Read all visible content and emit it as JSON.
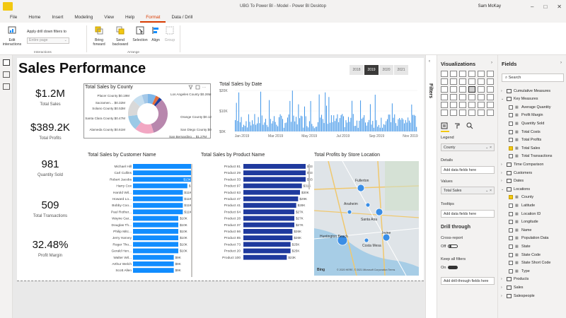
{
  "window": {
    "title": "UBG To Power BI - Model - Power BI Desktop",
    "user": "Sam McKay",
    "controls": [
      "–",
      "□",
      "✕"
    ]
  },
  "menu": {
    "items": [
      "File",
      "Home",
      "Insert",
      "Modeling",
      "View",
      "Help",
      "Format",
      "Data / Drill"
    ],
    "active": "Format"
  },
  "ribbon": {
    "edit_interactions": "Edit\ninteractions",
    "apply_filters_label": "Apply drill down filters to",
    "entire_page_placeholder": "Entire page",
    "interactions_group": "Interactions",
    "bring_forward": "Bring\nforward",
    "send_backward": "Send\nbackward",
    "selection": "Selection",
    "align": "Align",
    "group": "Group",
    "arrange_group": "Arrange"
  },
  "report": {
    "title": "Sales Performance",
    "years": [
      "2018",
      "2019",
      "2020",
      "2021"
    ],
    "selected_year": "2019",
    "kpis": [
      {
        "value": "$1.2M",
        "label": "Total Sales"
      },
      {
        "value": "$389.2K",
        "label": "Total Profits"
      },
      {
        "value": "981",
        "label": "Quantity Sold"
      },
      {
        "value": "509",
        "label": "Total Transactions"
      },
      {
        "value": "32.48%",
        "label": "Profit Margin"
      }
    ]
  },
  "chart_data": [
    {
      "type": "pie",
      "title": "Total Sales by County",
      "labels": [
        "Los Angeles County",
        "Orange County",
        "San Diego County",
        "San Bernardino County",
        "Alameda County",
        "Santa Clara County",
        "Solano County",
        "Sacramento County",
        "Placer County"
      ],
      "display": [
        "Los Angeles County $0.26M",
        "Orange County $0.12M",
        "San Diego County $0.1M",
        "San Bernardino… $1.27M",
        "Alameda County $0.61M",
        "Santa Clara County $0.47M",
        "Solano County $0.53M",
        "Sacramen… $0.32M",
        "Placer County $0.19M"
      ],
      "values": [
        0.26,
        0.12,
        0.1,
        1.27,
        0.61,
        0.47,
        0.53,
        0.32,
        0.19
      ],
      "colors": [
        "#7eb6e8",
        "#e66c37",
        "#1f3f9d",
        "#b887ad",
        "#f2a7c3",
        "#9bc9e6",
        "#d9d9d9",
        "#c7dff0",
        "#a4c8e8"
      ]
    },
    {
      "type": "bar",
      "title": "Total Sales by Date",
      "ylabel": "",
      "yticks": [
        "$20K",
        "$10K",
        "$0K"
      ],
      "xticks": [
        "Jan 2019",
        "Mar 2019",
        "May 2019",
        "Jul 2019",
        "Sep 2019",
        "Nov 2019"
      ],
      "color": "#2b8ae6"
    },
    {
      "type": "bar",
      "orientation": "horizontal",
      "title": "Total Sales by Customer Name",
      "categories": [
        "Michael Hill",
        "Carl Cullins",
        "Robert Jacobs",
        "Harry Cox",
        "Harold Wil...",
        "Howard Lo...",
        "Bobby Coo...",
        "Paul Rother...",
        "Wayne Gar...",
        "Douglas Th...",
        "Philip Mitc...",
        "Jerry Harvey",
        "Roger Tho...",
        "Gerald Hen...",
        "Walter Wil...",
        "Arthur Welch",
        "Scott Allen"
      ],
      "values": [
        15,
        15,
        13,
        12,
        11,
        11,
        11,
        11,
        10,
        10,
        10,
        10,
        10,
        10,
        9,
        9,
        9
      ],
      "labels": [
        "$15K",
        "$15K",
        "$13K",
        "$12K",
        "$11K",
        "$11K",
        "$11K",
        "$11K",
        "$10K",
        "$10K",
        "$10K",
        "$10K",
        "$10K",
        "$10K",
        "$9K",
        "$9K",
        "$9K"
      ],
      "colors": [
        "#118dff",
        "#118dff",
        "#118dff",
        "#118dff",
        "#118dff",
        "#118dff",
        "#118dff",
        "#118dff",
        "#118dff",
        "#118dff",
        "#118dff",
        "#118dff",
        "#118dff",
        "#118dff",
        "#118dff",
        "#118dff",
        "#118dff"
      ]
    },
    {
      "type": "bar",
      "orientation": "horizontal",
      "title": "Total Sales by Product Name",
      "categories": [
        "Product 81",
        "Product 29",
        "Product 33",
        "Product 97",
        "Product 63",
        "Product 47",
        "Product 41",
        "Product 64",
        "Product 28",
        "Product 37",
        "Product 66",
        "Product 85",
        "Product 73",
        "Product 20",
        "Product 100"
      ],
      "values": [
        33,
        33,
        33,
        31,
        30,
        29,
        28,
        27,
        27,
        27,
        26,
        26,
        25,
        25,
        23
      ],
      "labels": [
        "$33K",
        "$33K",
        "$33K",
        "$31K",
        "$30K",
        "$29K",
        "$28K",
        "$27K",
        "$27K",
        "$27K",
        "$26K",
        "$26K",
        "$25K",
        "$25K",
        "$23K"
      ],
      "color": "#1f3a9e"
    }
  ],
  "map": {
    "title": "Total Profits by Store Location",
    "places": [
      "Fullerton",
      "Santa Ana",
      "Anaheim",
      "Huntington Beach",
      "Costa Mesa",
      "Irvine"
    ],
    "attribution": "© 2020 HERE, © 2021 Microsoft Corporation Terms",
    "bing": "Bing"
  },
  "filters_label": "Filters",
  "viz_pane": {
    "title": "Visualizations",
    "legend_label": "Legend",
    "legend_value": "County",
    "details_label": "Details",
    "details_placeholder": "Add data fields here",
    "values_label": "Values",
    "values_value": "Total Sales",
    "tooltips_label": "Tooltips",
    "tooltips_placeholder": "Add data fields here",
    "drill_title": "Drill through",
    "cross_report": "Cross-report",
    "cross_state": "Off",
    "keep_filters": "Keep all filters",
    "keep_state": "On",
    "drill_placeholder": "Add drill-through fields here"
  },
  "fields_pane": {
    "title": "Fields",
    "search_placeholder": "Search",
    "rows": [
      {
        "kind": "table",
        "name": "Cumulative Measures",
        "open": false
      },
      {
        "kind": "table",
        "name": "Key Measures",
        "open": true
      },
      {
        "kind": "field",
        "name": "Average Quantity",
        "checked": false
      },
      {
        "kind": "field",
        "name": "Profit Margin",
        "checked": false
      },
      {
        "kind": "field",
        "name": "Quantity Sold",
        "checked": false
      },
      {
        "kind": "field",
        "name": "Total Costs",
        "checked": false
      },
      {
        "kind": "field",
        "name": "Total Profits",
        "checked": false
      },
      {
        "kind": "field",
        "name": "Total Sales",
        "checked": true
      },
      {
        "kind": "field",
        "name": "Total Transactions",
        "checked": false
      },
      {
        "kind": "table",
        "name": "Time Comparison",
        "open": false
      },
      {
        "kind": "table",
        "name": "Customers",
        "open": false
      },
      {
        "kind": "table",
        "name": "Dates",
        "open": false
      },
      {
        "kind": "table",
        "name": "Locations",
        "open": true
      },
      {
        "kind": "field",
        "name": "County",
        "checked": true
      },
      {
        "kind": "field",
        "name": "Latitude",
        "checked": false
      },
      {
        "kind": "field",
        "name": "Location ID",
        "checked": false
      },
      {
        "kind": "field",
        "name": "Longitude",
        "checked": false
      },
      {
        "kind": "field",
        "name": "Name",
        "checked": false
      },
      {
        "kind": "field",
        "name": "Population Data",
        "checked": false
      },
      {
        "kind": "field",
        "name": "State",
        "checked": false
      },
      {
        "kind": "field",
        "name": "State Code",
        "checked": false
      },
      {
        "kind": "field",
        "name": "State Short Code",
        "checked": false
      },
      {
        "kind": "field",
        "name": "Type",
        "checked": false
      },
      {
        "kind": "table",
        "name": "Products",
        "open": false
      },
      {
        "kind": "table",
        "name": "Sales",
        "open": false
      },
      {
        "kind": "table",
        "name": "Salespeople",
        "open": false
      }
    ]
  }
}
